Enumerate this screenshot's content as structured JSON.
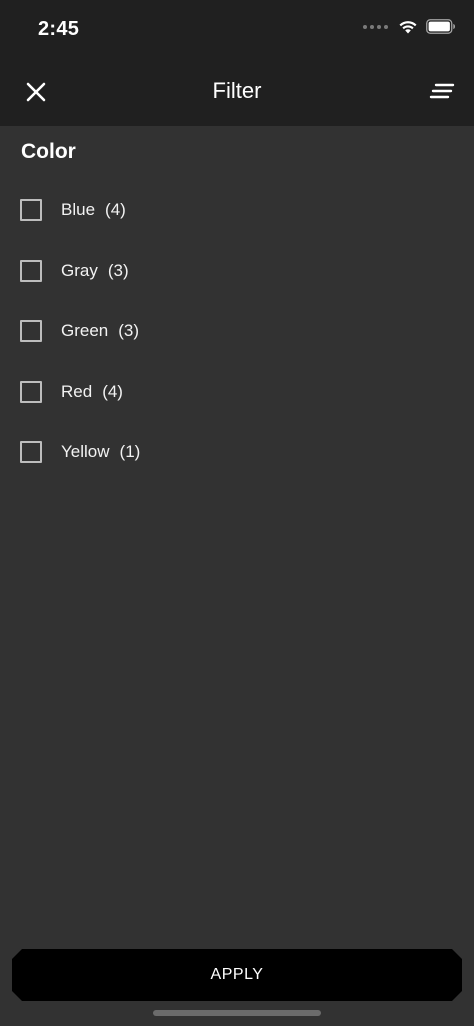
{
  "status_bar": {
    "time": "2:45",
    "icons": [
      "signal-dots-icon",
      "wifi-icon",
      "battery-icon"
    ]
  },
  "nav": {
    "title": "Filter",
    "close_icon": "close-icon",
    "sort_icon": "sort-lines-icon"
  },
  "section": {
    "title": "Color"
  },
  "options": [
    {
      "label": "Blue",
      "count": "(4)",
      "checked": false
    },
    {
      "label": "Gray",
      "count": "(3)",
      "checked": false
    },
    {
      "label": "Green",
      "count": "(3)",
      "checked": false
    },
    {
      "label": "Red",
      "count": "(4)",
      "checked": false
    },
    {
      "label": "Yellow",
      "count": "(1)",
      "checked": false
    }
  ],
  "apply": {
    "label": "APPLY"
  },
  "colors": {
    "background": "#323232",
    "header": "#202020",
    "button": "#000000",
    "checkbox_border": "#bdbdbd",
    "text": "#ffffff"
  }
}
